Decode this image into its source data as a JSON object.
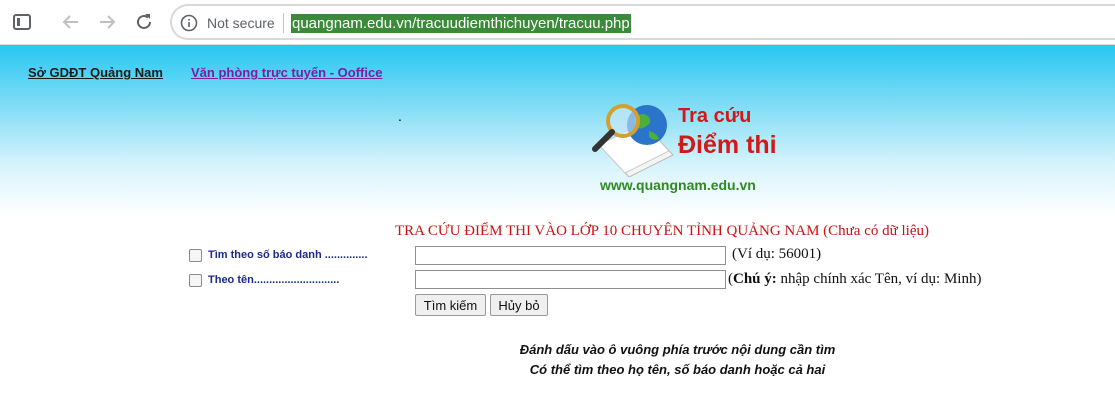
{
  "browser": {
    "security_label": "Not secure",
    "url": "quangnam.edu.vn/tracuudiemthichuyen/tracuu.php"
  },
  "toplinks": {
    "home": "Sở GDĐT Quảng Nam",
    "office": "Văn phòng trực tuyến - Ooffice"
  },
  "dot": ".",
  "logo": {
    "line1": "Tra cứu",
    "line2": "Điểm thi",
    "site": "www.quangnam.edu.vn"
  },
  "form": {
    "title": "TRA CỨU ĐIỂM THI VÀO LỚP 10 CHUYÊN TỈNH QUẢNG NAM (Chưa có dữ liệu)",
    "sbd_label": "Tìm theo số báo danh ..............",
    "sbd_value": "",
    "sbd_hint": "(Ví dụ: 56001)",
    "name_label": "Theo tên............................",
    "name_value": "",
    "name_hint_bold": "Chú ý:",
    "name_hint_open": "(",
    "name_hint_rest": " nhập chính xác Tên, ví dụ: Minh)",
    "search_button": "Tìm kiếm",
    "cancel_button": "Hủy bỏ"
  },
  "notes": {
    "line1": "Đánh dấu vào ô vuông phía trước nội dung cần tìm",
    "line2": "Có thể tìm theo họ tên, số báo danh hoặc cả hai"
  },
  "colors": {
    "banner_top": "#27c7f2",
    "title_red": "#cc1111",
    "label_blue": "#1a2a8f",
    "url_highlight": "#3a8a3a"
  }
}
